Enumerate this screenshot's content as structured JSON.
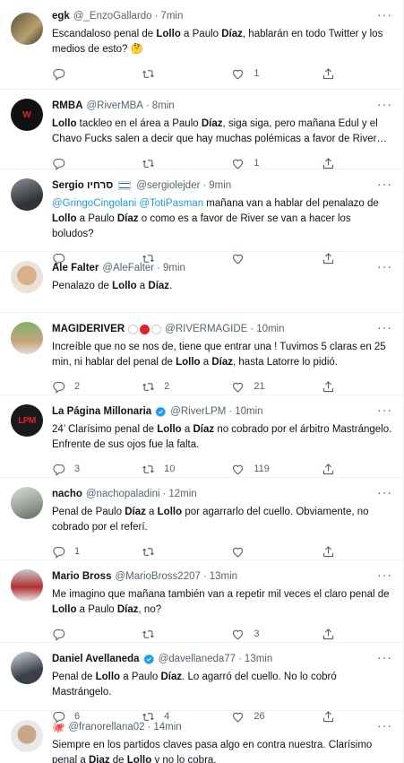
{
  "colors": {
    "accent": "#1d9bf0",
    "muted": "#536471",
    "text": "#0f1419",
    "divider": "#eff3f4"
  },
  "tweets": [
    {
      "name": "egk",
      "handle": "@_EnzoGallardo",
      "time": "7min",
      "segments": [
        [
          "t",
          "Escandaloso penal de "
        ],
        [
          "b",
          "Lollo"
        ],
        [
          "t",
          " a Paulo "
        ],
        [
          "b",
          "Díaz"
        ],
        [
          "t",
          ", hablarán en todo Twitter y los medios de esto? 🤔"
        ]
      ],
      "reply": "",
      "retweet": "",
      "like": "1"
    },
    {
      "name": "RMBA",
      "handle": "@RiverMBA",
      "time": "8min",
      "segments": [
        [
          "b",
          "Lollo"
        ],
        [
          "t",
          " tackleo en el área a Paulo "
        ],
        [
          "b",
          "Díaz"
        ],
        [
          "t",
          ", siga siga, pero mañana Edul y el Chavo Fucks salen a decir que hay muchas polémicas a favor de River…"
        ]
      ],
      "reply": "",
      "retweet": "",
      "like": "1"
    },
    {
      "name": "Sergio סרחיו",
      "handle": "@sergiolejder",
      "time": "9min",
      "segments": [
        [
          "m",
          "@GringoCingolani"
        ],
        [
          "t",
          " "
        ],
        [
          "m",
          "@TotiPasman"
        ],
        [
          "t",
          " mañana van a hablar del penalazo de "
        ],
        [
          "b",
          "Lollo"
        ],
        [
          "t",
          " a Paulo "
        ],
        [
          "b",
          "Díaz"
        ],
        [
          "t",
          " o como es a favor de River se van a hacer los boludos?"
        ]
      ],
      "reply": "",
      "retweet": "",
      "like": ""
    },
    {
      "name": "Ale Falter",
      "handle": "@AleFalter",
      "time": "9min",
      "segments": [
        [
          "t",
          "Penalazo de "
        ],
        [
          "b",
          "Lollo"
        ],
        [
          "t",
          " a "
        ],
        [
          "b",
          "Díaz"
        ],
        [
          "t",
          "."
        ]
      ],
      "reply": "",
      "retweet": "",
      "like": ""
    },
    {
      "name": "MAGIDERIVER",
      "handle": "@RIVERMAGIDE",
      "time": "10min",
      "segments": [
        [
          "t",
          "Increíble que no se nos de, tiene que entrar una ! Tuvimos 5 claras en 25 min, ni hablar del penal de "
        ],
        [
          "b",
          "Lollo"
        ],
        [
          "t",
          " a "
        ],
        [
          "b",
          "Díaz"
        ],
        [
          "t",
          ", hasta Latorre lo pidió."
        ]
      ],
      "reply": "2",
      "retweet": "2",
      "like": "21"
    },
    {
      "name": "La Página Millonaria",
      "handle": "@RiverLPM",
      "time": "10min",
      "segments": [
        [
          "t",
          "24’ Clarísimo penal de "
        ],
        [
          "b",
          "Lollo"
        ],
        [
          "t",
          " a "
        ],
        [
          "b",
          "Díaz"
        ],
        [
          "t",
          " no cobrado por el árbitro Mastrángelo. Enfrente de sus ojos fue la falta."
        ]
      ],
      "reply": "3",
      "retweet": "10",
      "like": "119"
    },
    {
      "name": "nacho",
      "handle": "@nachopaladini",
      "time": "12min",
      "segments": [
        [
          "t",
          "Penal de Paulo "
        ],
        [
          "b",
          "Díaz"
        ],
        [
          "t",
          " a "
        ],
        [
          "b",
          "Lollo"
        ],
        [
          "t",
          " por agarrarlo del cuello. Obviamente, no cobrado por el referí."
        ]
      ],
      "reply": "1",
      "retweet": "",
      "like": ""
    },
    {
      "name": "Mario Bross",
      "handle": "@MarioBross2207",
      "time": "13min",
      "segments": [
        [
          "t",
          "Me imagino que mañana también van a repetir mil veces el claro penal de "
        ],
        [
          "b",
          "Lollo"
        ],
        [
          "t",
          " a Paulo "
        ],
        [
          "b",
          "Díaz"
        ],
        [
          "t",
          ", no?"
        ]
      ],
      "reply": "",
      "retweet": "",
      "like": "3"
    },
    {
      "name": "Daniel Avellaneda",
      "handle": "@davellaneda77",
      "time": "13min",
      "segments": [
        [
          "t",
          "Penal de "
        ],
        [
          "b",
          "Lollo"
        ],
        [
          "t",
          " a Paulo "
        ],
        [
          "b",
          "Díaz"
        ],
        [
          "t",
          ". Lo agarró del cuello. No lo cobró Mastrángelo."
        ]
      ],
      "reply": "6",
      "retweet": "4",
      "like": "26"
    },
    {
      "name": "",
      "handle": "@franorellana02",
      "time": "14min",
      "segments": [
        [
          "t",
          "Siempre en los partidos claves pasa algo en contra nuestra. Clarísimo penal a "
        ],
        [
          "b",
          "Diaz"
        ],
        [
          "t",
          " de "
        ],
        [
          "b",
          "Lollo"
        ],
        [
          "t",
          " y no lo cobra."
        ]
      ],
      "reply": "",
      "retweet": "",
      "like": ""
    }
  ]
}
